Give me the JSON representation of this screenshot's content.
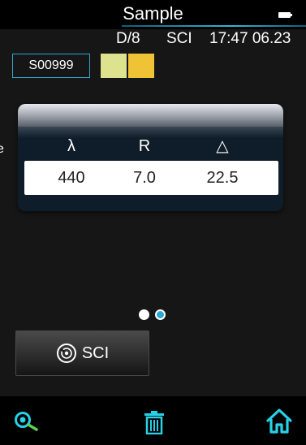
{
  "header": {
    "title": "Sample",
    "geometry": "D/8",
    "mode": "SCI",
    "time": "17:47 06.23"
  },
  "sample": {
    "id": "S00999",
    "swatch_colors": [
      "#dde28f",
      "#f0c336"
    ]
  },
  "side_text": "e",
  "table": {
    "headers": [
      "λ",
      "R",
      "△"
    ],
    "row": [
      "440",
      "7.0",
      "22.5"
    ]
  },
  "pager": {
    "pages": 2,
    "active": 2
  },
  "sci_button": {
    "label": "SCI"
  },
  "bottom_nav": {
    "icons": [
      "probe-icon",
      "trash-icon",
      "home-icon"
    ]
  },
  "colors": {
    "accent": "#31a6cc",
    "icon_cyan": "#27d1e6",
    "probe_green": "#5ed04c"
  }
}
